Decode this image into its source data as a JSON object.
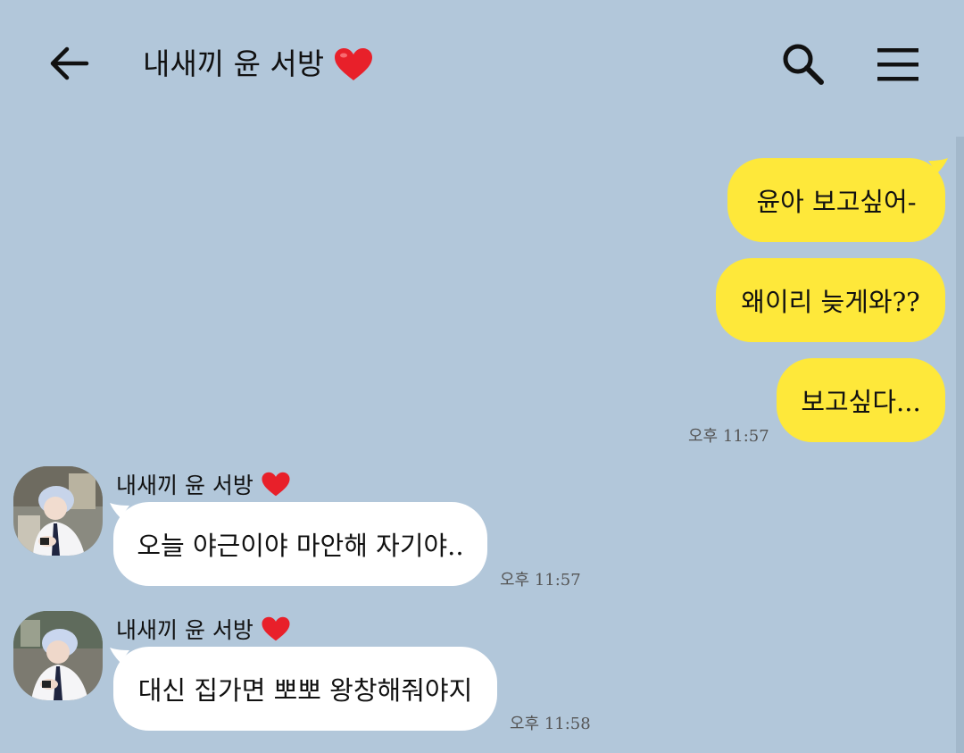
{
  "header": {
    "title": "내새끼 윤 서방",
    "title_icon": "red-heart-icon",
    "back_icon": "arrow-left-icon",
    "search_icon": "search-icon",
    "menu_icon": "hamburger-menu-icon"
  },
  "colors": {
    "background": "#b2c7da",
    "my_bubble": "#fee83a",
    "their_bubble": "#ffffff",
    "heart": "#e8202a"
  },
  "messages": [
    {
      "from": "me",
      "text": "윤아 보고싶어-"
    },
    {
      "from": "me",
      "text": "왜이리 늦게와??"
    },
    {
      "from": "me",
      "text": "보고싶다...",
      "time": "오후 11:57"
    },
    {
      "from": "them",
      "sender": "내새끼 윤 서방",
      "text": "오늘 야근이야 마안해 자기야..",
      "time": "오후 11:57"
    },
    {
      "from": "them",
      "sender": "내새끼 윤 서방",
      "text": "대신 집가면 뽀뽀 왕창해줘야지",
      "time": "오후 11:58"
    }
  ]
}
